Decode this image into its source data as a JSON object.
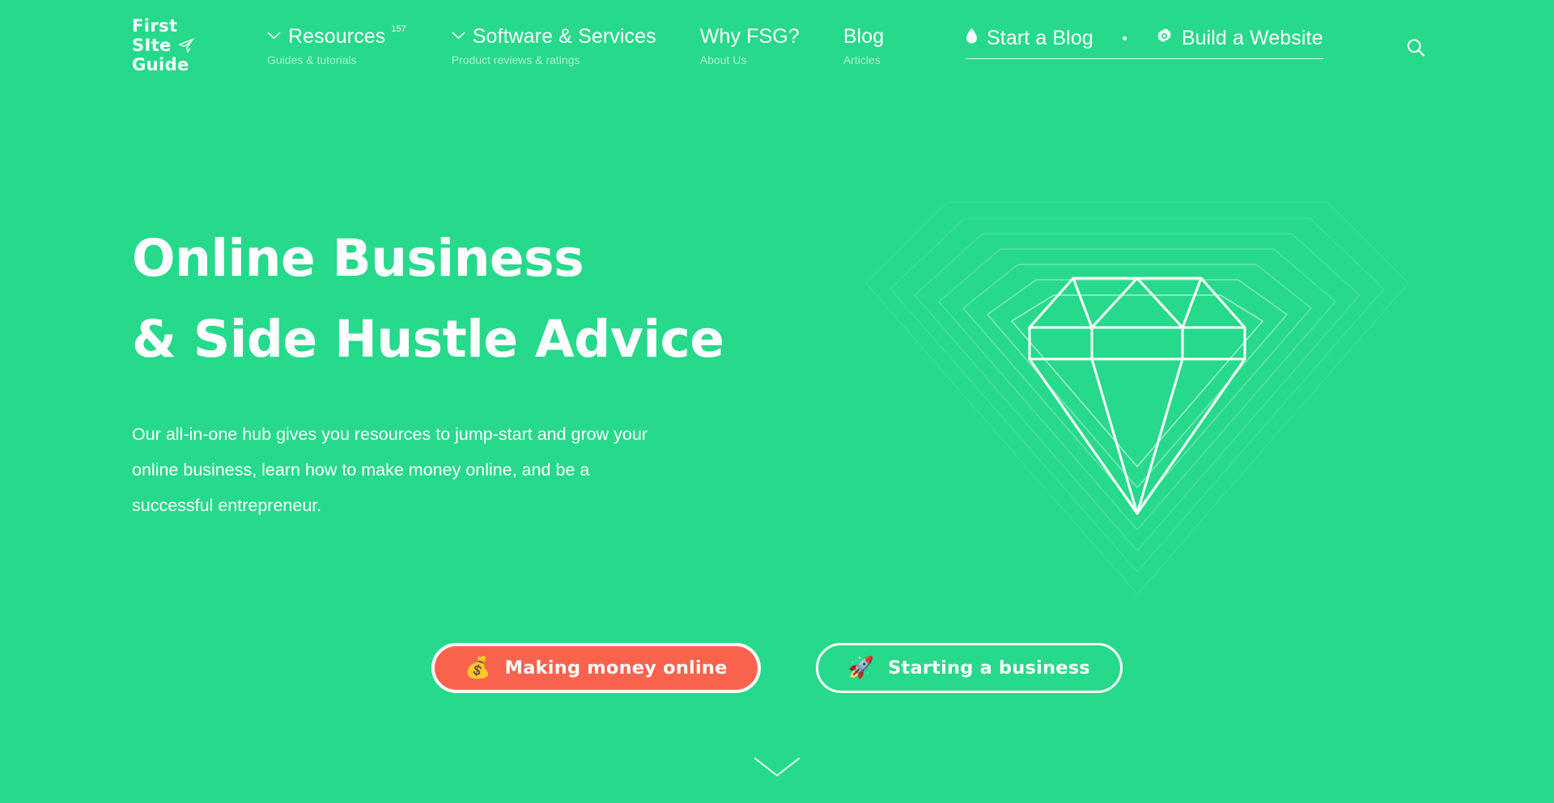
{
  "brand": {
    "logo_line1": "First",
    "logo_line2": "SIte",
    "logo_line3": "Guide",
    "plane_icon": "paper-plane-icon"
  },
  "nav": {
    "items": [
      {
        "label": "Resources",
        "superscript": "157",
        "sublabel": "Guides & tutorials",
        "has_caret": true
      },
      {
        "label": "Software & Services",
        "superscript": "",
        "sublabel": "Product reviews & ratings",
        "has_caret": true
      },
      {
        "label": "Why FSG?",
        "superscript": "",
        "sublabel": "About Us",
        "has_caret": false
      },
      {
        "label": "Blog",
        "superscript": "",
        "sublabel": "Articles",
        "has_caret": false
      }
    ]
  },
  "header_actions": {
    "start_blog": {
      "label": "Start a Blog",
      "icon": "ink-drop-icon"
    },
    "separator": "•",
    "build_website": {
      "label": "Build a Website",
      "icon": "gear-icon"
    }
  },
  "search": {
    "icon": "search-icon",
    "label": "Search"
  },
  "hero": {
    "title_line1": "Online Business",
    "title_line2": "& Side Hustle Advice",
    "paragraph": "Our all-in-one hub gives you resources to jump-start and grow your online business, learn how to make money online, and be a successful entrepreneur.",
    "artwork": "diamond-outline-graphic"
  },
  "cta": {
    "primary": {
      "label": "Making money online",
      "emoji": "💰"
    },
    "secondary": {
      "label": "Starting a business",
      "emoji": "🚀"
    }
  },
  "scroll_cue": {
    "icon": "chevron-down-icon"
  },
  "colors": {
    "background": "#27d98a",
    "primary_button": "#f9634e",
    "text": "#ffffff"
  }
}
